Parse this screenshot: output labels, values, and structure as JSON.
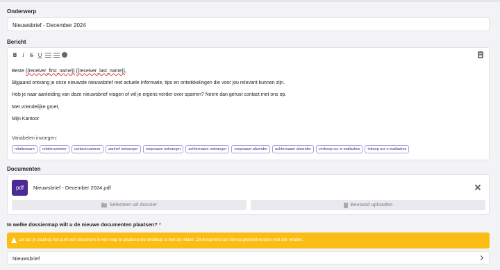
{
  "subject": {
    "label": "Onderwerp",
    "value": "Nieuwsbrief - December 2024"
  },
  "message": {
    "label": "Bericht",
    "toolbar": {
      "bold": "B",
      "italic": "I",
      "strike": "S",
      "underline": "U"
    },
    "body": {
      "greeting_prefix": "Beste ",
      "greeting_first": "{{receiver_first_name}}",
      "greeting_space": " ",
      "greeting_last": "{{receiver_last_name}}",
      "greeting_suffix": ",",
      "line1": "Bijgaand ontvang je onze nieuwste nieuwsbrief met actuele informatie, tips en ontwikkelingen die voor jou relevant kunnen zijn.",
      "line2": "Heb je naar aanleiding van deze nieuwsbrief vragen of wil je ergens verder over sparren? Neem dan gerust contact met ons op.",
      "line3": "Met vriendelijke groet,",
      "line4": "Mijn Kantoor"
    },
    "variables_label": "Variabelen invoegen:",
    "variables": [
      "relatienaam",
      "relatienummer",
      "contactnummer",
      "aanhef ontvanger",
      "roepnaam ontvanger",
      "achternaam ontvanger",
      "roepnaam afzender",
      "achternaam afzender",
      "verkoop ocr-e-mailadres",
      "inkoop ocr-e-mailadres"
    ]
  },
  "documents": {
    "label": "Documenten",
    "file_badge": "pdf",
    "file_name": "Nieuwsbrief - December 2024.pdf",
    "select_button": "Selecteer uit dossier",
    "upload_button": "Bestand uploaden"
  },
  "folder": {
    "question": "In welke dossiermap wilt u de nieuwe documenten plaatsen?",
    "required_mark": "*",
    "warning": "Let op: je staat op het punt een document in een map te plaatsen die deelbaar is met de relatie. Dit document kan hierna gedeeld worden met alle relaties.",
    "selected": "Nieuwsbrief"
  },
  "colors": {
    "accent": "#4b2a96",
    "warning": "#fbbd14",
    "chip_text": "#3a2d86"
  }
}
